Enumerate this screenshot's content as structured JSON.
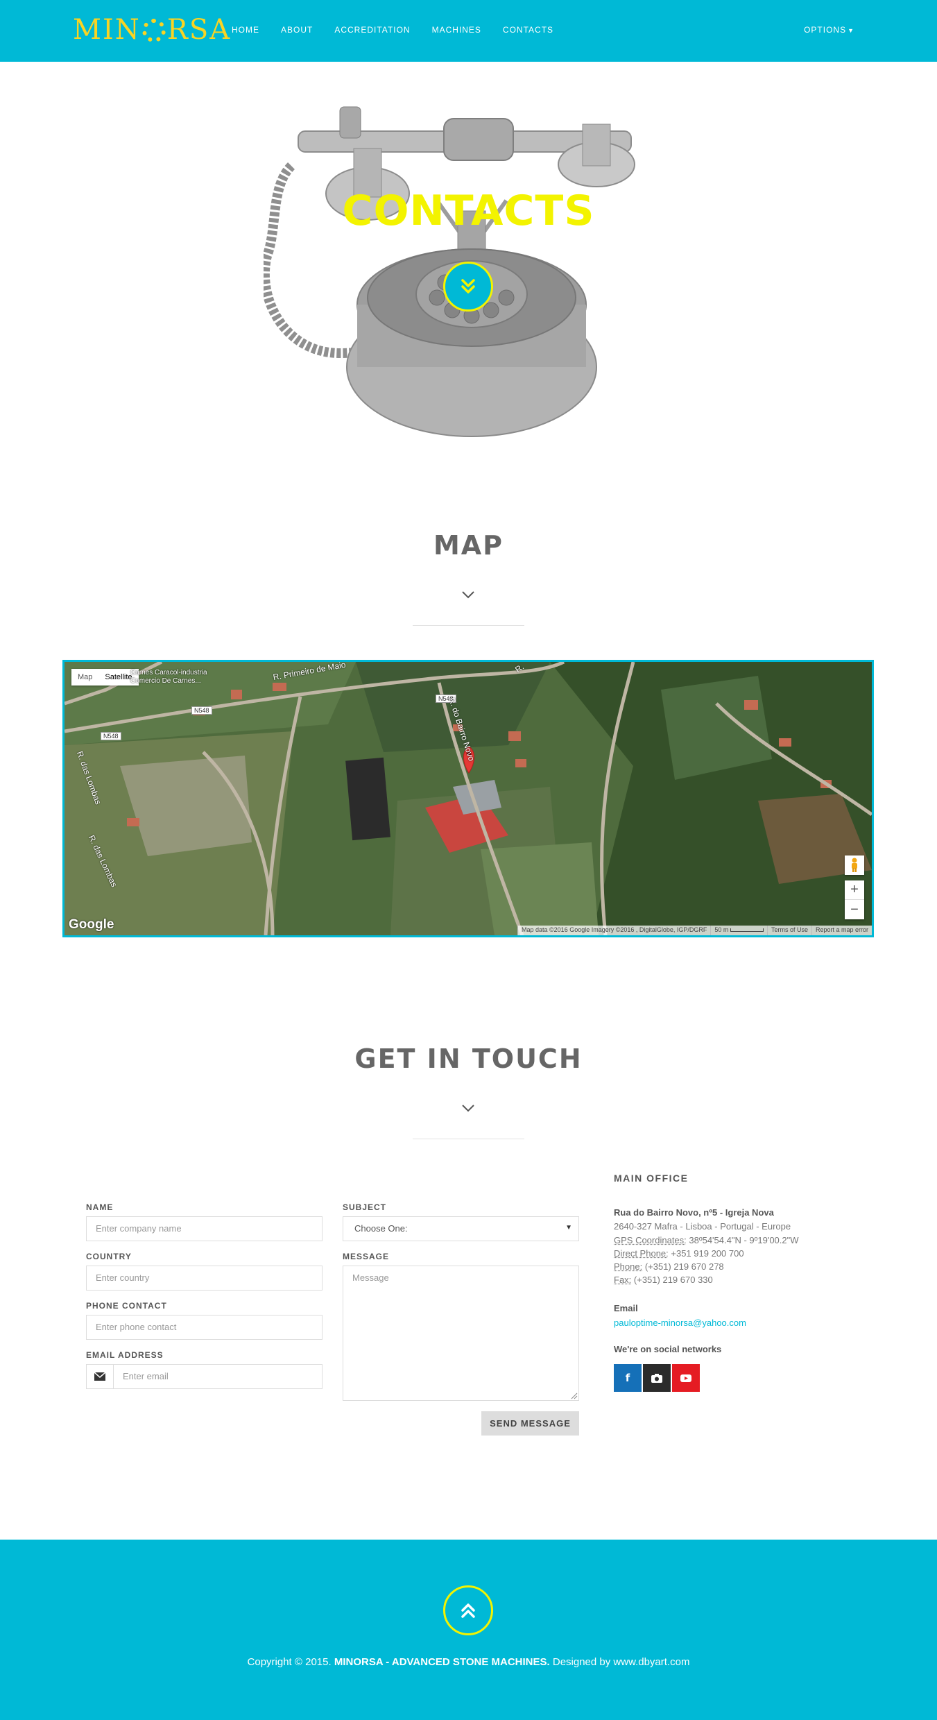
{
  "nav": {
    "logo": "MINORSA",
    "links": [
      "HOME",
      "ABOUT",
      "ACCREDITATION",
      "MACHINES",
      "CONTACTS"
    ],
    "options": "OPTIONS"
  },
  "hero": {
    "title": "CONTACTS"
  },
  "map_section": {
    "title": "MAP",
    "map": {
      "type_map": "Map",
      "type_satellite": "Satellite",
      "poi_line1": "Carnes Caracol-industria",
      "poi_line2": "Comercio De Carnes...",
      "road_primeiro": "R. Primeiro de Maio",
      "road_n548_a": "N548",
      "road_n548_b": "N548",
      "road_n548_c": "N548",
      "road_right": "R.",
      "road_left_a": "R. das Lombas",
      "road_left_b": "R. das Lombas",
      "road_center": "R. do Bairro Novo",
      "zoom_in": "+",
      "zoom_out": "−",
      "google": "Google",
      "attribution": "Map data ©2016 Google Imagery ©2016 , DigitalGlobe, IGP/DGRF",
      "scale": "50 m",
      "terms": "Terms of Use",
      "report": "Report a map error"
    }
  },
  "contact_section": {
    "title": "GET IN TOUCH",
    "form": {
      "name_label": "NAME",
      "name_placeholder": "Enter company name",
      "country_label": "COUNTRY",
      "country_placeholder": "Enter country",
      "phone_label": "PHONE CONTACT",
      "phone_placeholder": "Enter phone contact",
      "email_label": "EMAIL ADDRESS",
      "email_placeholder": "Enter email",
      "subject_label": "SUBJECT",
      "subject_value": "Choose One:",
      "message_label": "MESSAGE",
      "message_placeholder": "Message",
      "send_label": "SEND MESSAGE"
    },
    "office": {
      "title": "MAIN OFFICE",
      "address": "Rua do Bairro Novo, nº5 - Igreja Nova",
      "city": "2640-327 Mafra - Lisboa - Portugal - Europe",
      "gps_label": "GPS Coordinates:",
      "gps_value": " 38º54'54.4\"N - 9º19'00.2\"W",
      "direct_label": "Direct Phone:",
      "direct_value": " +351 919 200 700",
      "phone_label": "Phone:",
      "phone_value": " (+351) 219 670 278",
      "fax_label": "Fax:",
      "fax_value": " (+351) 219 670 330",
      "email_title": "Email",
      "email": "pauloptime-minorsa@yahoo.com",
      "social_title": "We're on social networks",
      "social": [
        {
          "icon": "facebook-icon",
          "color": "#1570b8"
        },
        {
          "icon": "camera-icon",
          "color": "#2b2b2b"
        },
        {
          "icon": "youtube-icon",
          "color": "#e51c23"
        }
      ]
    }
  },
  "footer": {
    "copy_prefix": "Copyright © 2015. ",
    "copy_brand": "MINORSA - ADVANCED STONE MACHINES.",
    "copy_suffix": " Designed by www.dbyart.com"
  },
  "colors": {
    "accent": "#00b9d6",
    "yellow": "#f3f300",
    "logo": "#f9d423"
  }
}
